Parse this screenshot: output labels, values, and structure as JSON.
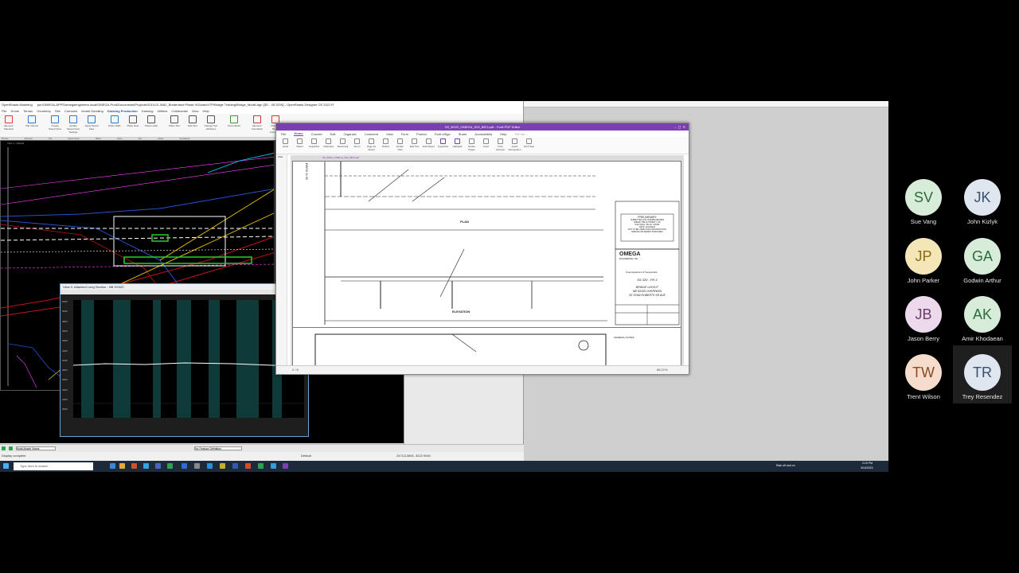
{
  "openroads": {
    "app_title": "OpenRoads Modeling",
    "window_title": "pw:\\OMEGA-APPS\\omegaengineers.local\\OMEGA-Prod\\Documents\\Projects\\2019-01-WA2_Borderland Phase II\\Scratch\\TP\\Bridge Training\\Bridge_Model.dgn [3D - V8 DGN] - OpenRoads Designer CE 2021 R",
    "tabs": [
      "File",
      "Home",
      "Terrain",
      "Geometry",
      "Site",
      "Corridors",
      "Model Detailing",
      "Drawing Production",
      "Drawing",
      "Utilities",
      "Collaborate",
      "View",
      "Help"
    ],
    "active_tab": "Drawing Production",
    "ribbon_groups": [
      "Primary",
      "Selection",
      "Clip",
      "Saved Views",
      "Tables",
      "Notes",
      "Text",
      "Labels",
      "Annotations"
    ],
    "ribbon_buttons": [
      "Element Selection",
      "Clip Volume",
      "Create Saved View",
      "Update Saved View Settings",
      "Apply Saved View",
      "Place Table",
      "Place Note",
      "Place Label",
      "Place Text",
      "Edit Text",
      "Change Text Attributes",
      "Civil Labeler",
      "Element Annotation",
      "Drawing Model Annotation"
    ],
    "view_label": "View 1 - Default",
    "profile_title": "View 2, Attached Long Section - NB SS320",
    "profile_y_ticks": [
      "5200",
      "5000",
      "4800",
      "4600",
      "4400",
      "4200",
      "4000",
      "3800",
      "3600",
      "3400",
      "3200",
      "3000"
    ],
    "view_selector": "Multi-Model Views",
    "feature_def": "No Feature Definition",
    "status_left": "Display complete",
    "status_level": "Default",
    "status_coords": "2471113894, 3222.9040"
  },
  "pdf": {
    "window_title": "SS_BS22_OMEGA_S02_BRG.pdf - Foxit PDF Editor",
    "menu": [
      "File",
      "Home",
      "Convert",
      "Edit",
      "Organize",
      "Comment",
      "View",
      "Form",
      "Protect",
      "Foxit eSign",
      "Share",
      "Accessibility",
      "Help"
    ],
    "active_menu": "Home",
    "tell_me": "Tell me...",
    "tools": [
      "Hand",
      "Select",
      "SnapShot",
      "Clipboard",
      "Bookmark",
      "Zoom",
      "Page Fit Option",
      "Reflow",
      "Rotate View",
      "Edit Text",
      "Edit Object",
      "Typewriter",
      "Highlight",
      "Rotate Pages",
      "Insert",
      "From Scanner",
      "Quick Recognition",
      "Fill & Sign"
    ],
    "tab_start": "Start",
    "doc_tab": "SS_BS22_OMEGA_S02_BRG.pdf",
    "sheet": {
      "plan_label": "PLAN",
      "elevation_label": "ELEVATION",
      "stamp_title": "PRELIMINARY",
      "stamp_lines": [
        "SUBMITTED FOR INTERIM REVIEW",
        "UNDER THE AUTHORITY OF:",
        "SUE VANG, PE No. 125331",
        "DATE: 11/01/2022",
        "NOT TO BE USED FOR CONSTRUCTION,",
        "BIDDING OR PERMIT PURPOSES"
      ],
      "firm": "OMEGA",
      "firm_sub": "ENGINEERING, INC.",
      "dot": "Texas Department of Transportation",
      "project": "SS 320 - PH 2",
      "title_line1": "BRIDGE LAYOUT",
      "title_line2": "NB SS320 OVERPASS",
      "title_line3": "AT STAN ROBERTS SR AVE",
      "general_notes": "GENERAL NOTES:",
      "side_label": "30 % SUBM"
    },
    "page_nav": "2 / 8",
    "zoom": "65.21%"
  },
  "taskbar": {
    "search_placeholder": "Type here to search",
    "weather": "Rain off and on",
    "time": "2:15 PM",
    "date": "3/16/2023"
  },
  "participants": [
    {
      "initials": "SV",
      "name": "Sue Vang",
      "bg": "#d7ecd9",
      "fg": "#2e6b3a"
    },
    {
      "initials": "JK",
      "name": "John Kizlyk",
      "bg": "#dfe6ef",
      "fg": "#3a4f6b"
    },
    {
      "initials": "JP",
      "name": "John Parker",
      "bg": "#f5e6b8",
      "fg": "#8a6a12"
    },
    {
      "initials": "GA",
      "name": "Godwin Arthur",
      "bg": "#d7ecd9",
      "fg": "#2e6b3a"
    },
    {
      "initials": "JB",
      "name": "Jason Berry",
      "bg": "#ecd9ec",
      "fg": "#6b3a6b"
    },
    {
      "initials": "AK",
      "name": "Amir Khodaean",
      "bg": "#d7ecd9",
      "fg": "#2e6b3a"
    },
    {
      "initials": "TW",
      "name": "Trent Wilson",
      "bg": "#f5dccc",
      "fg": "#8a4a22"
    },
    {
      "initials": "TR",
      "name": "Trey Resendez",
      "bg": "#dfe6ef",
      "fg": "#3a4f6b"
    }
  ]
}
